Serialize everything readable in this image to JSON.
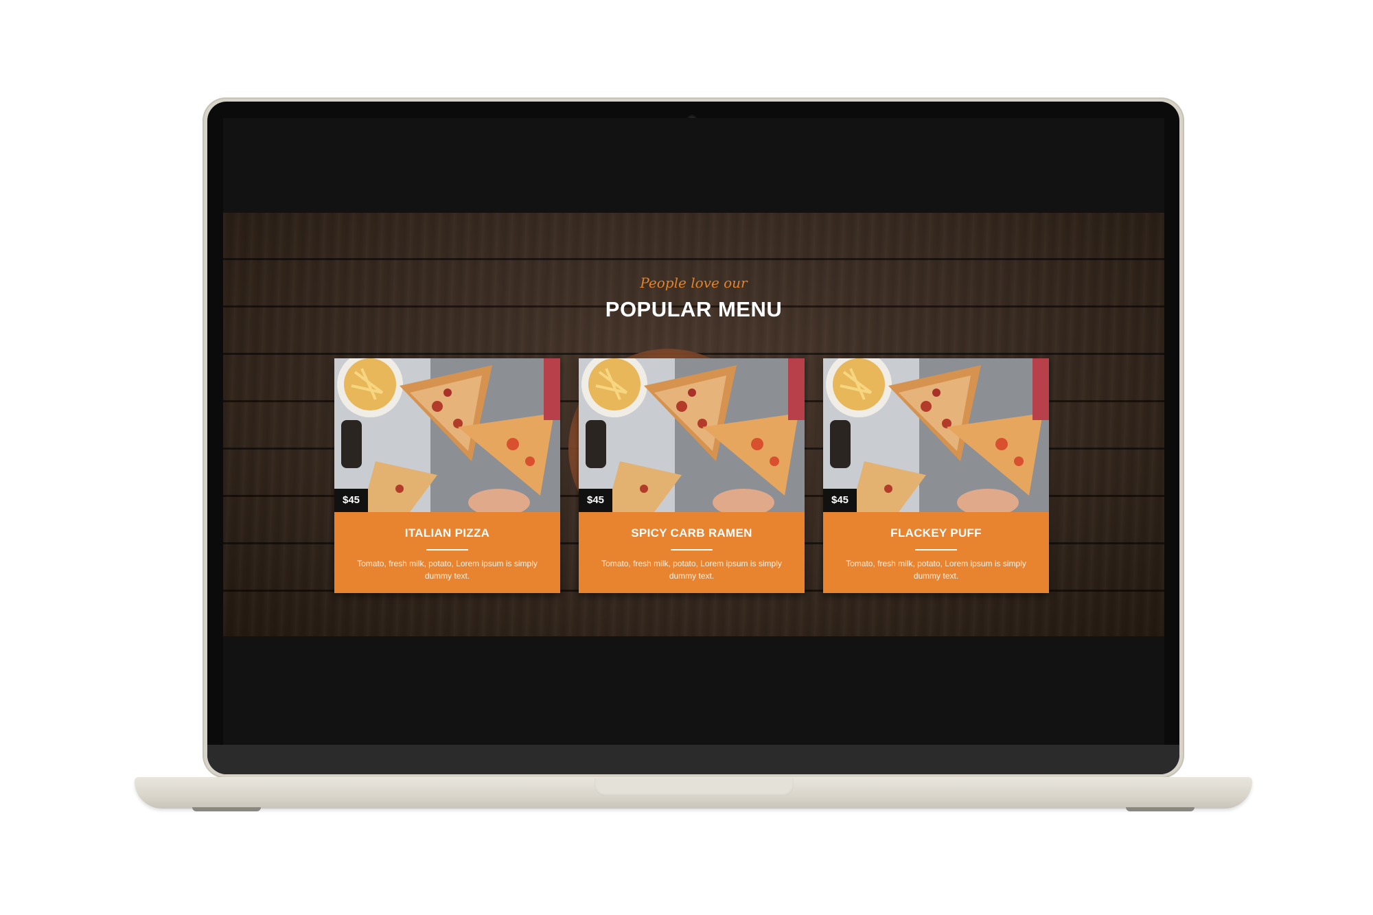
{
  "section": {
    "eyebrow": "People love our",
    "title": "POPULAR MENU"
  },
  "cards": [
    {
      "price": "$45",
      "name": "ITALIAN PIZZA",
      "description": "Tomato, fresh milk, potato, Lorem ipsum is simply dummy text."
    },
    {
      "price": "$45",
      "name": "SPICY CARB RAMEN",
      "description": "Tomato, fresh milk, potato, Lorem ipsum is simply dummy text."
    },
    {
      "price": "$45",
      "name": "FLACKEY PUFF",
      "description": "Tomato, fresh milk, potato, Lorem ipsum is simply dummy text."
    }
  ],
  "colors": {
    "accent": "#e8832f",
    "eyebrow": "#e1832a",
    "price_badge": "#111111"
  },
  "icons": {
    "card_image": "pizza-photo"
  }
}
